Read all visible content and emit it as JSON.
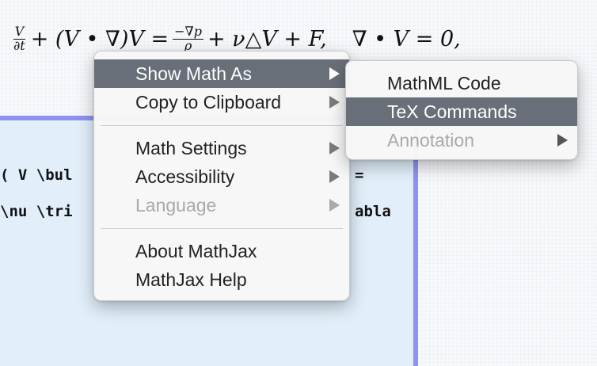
{
  "equation": {
    "frac1_num": "V",
    "frac1_den": "∂t",
    "part1": "+ (V • ∇)V =",
    "frac2_num": "−∇p",
    "frac2_den": "ρ",
    "part2": "+ ν△V + F,",
    "part3": "∇ • V = 0,"
  },
  "tex_panel": {
    "line1": "( V \\bul",
    "line2": "\\nu \\tri",
    "frag1": "=",
    "frag2": "abla"
  },
  "main_menu": {
    "items": [
      {
        "label": "Show Math As",
        "has_submenu": true,
        "state": "selected"
      },
      {
        "label": "Copy to Clipboard",
        "has_submenu": true,
        "state": "normal"
      },
      {
        "label": "Math Settings",
        "has_submenu": true,
        "state": "normal"
      },
      {
        "label": "Accessibility",
        "has_submenu": true,
        "state": "normal"
      },
      {
        "label": "Language",
        "has_submenu": true,
        "state": "disabled"
      },
      {
        "label": "About MathJax",
        "has_submenu": false,
        "state": "normal"
      },
      {
        "label": "MathJax Help",
        "has_submenu": false,
        "state": "normal"
      }
    ]
  },
  "sub_menu": {
    "items": [
      {
        "label": "MathML Code",
        "has_submenu": false,
        "state": "normal"
      },
      {
        "label": "TeX Commands",
        "has_submenu": false,
        "state": "selected"
      },
      {
        "label": "Annotation",
        "has_submenu": true,
        "state": "disabled"
      }
    ]
  },
  "colors": {
    "menu_highlight": "#686f78",
    "panel_background": "#e2effb",
    "panel_border": "#8e94ee",
    "disabled_text": "#a9a9a9"
  }
}
